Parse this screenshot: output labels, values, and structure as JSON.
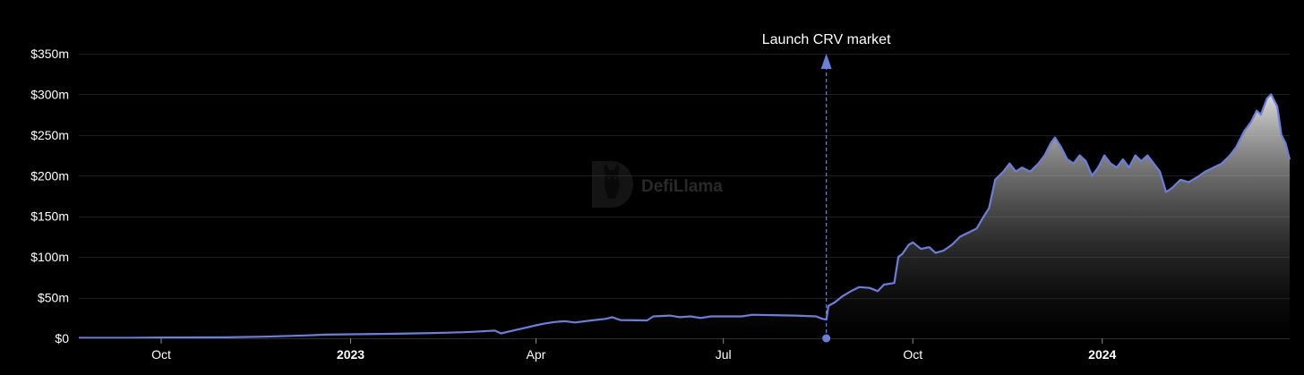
{
  "chart_data": {
    "type": "area",
    "title": "",
    "xlabel": "",
    "ylabel": "",
    "y_unit": "$",
    "ylim": [
      0,
      350
    ],
    "yticks": [
      {
        "value": 0,
        "label": "$0"
      },
      {
        "value": 50,
        "label": "$50m"
      },
      {
        "value": 100,
        "label": "$100m"
      },
      {
        "value": 150,
        "label": "$150m"
      },
      {
        "value": 200,
        "label": "$200m"
      },
      {
        "value": 250,
        "label": "$250m"
      },
      {
        "value": 300,
        "label": "$300m"
      },
      {
        "value": 350,
        "label": "$350m"
      }
    ],
    "xlim": [
      "2022-08-22",
      "2024-04-01"
    ],
    "xticks": [
      {
        "date": "2022-10-01",
        "label": "Oct",
        "bold": false
      },
      {
        "date": "2023-01-01",
        "label": "2023",
        "bold": true
      },
      {
        "date": "2023-04-01",
        "label": "Apr",
        "bold": false
      },
      {
        "date": "2023-07-01",
        "label": "Jul",
        "bold": false
      },
      {
        "date": "2023-10-01",
        "label": "Oct",
        "bold": false
      },
      {
        "date": "2024-01-01",
        "label": "2024",
        "bold": true
      }
    ],
    "grid": true,
    "line_color": "#6a7fdb",
    "fill_top_color": "#ffffff",
    "fill_bottom_color": "#000000",
    "background": "#000000",
    "annotation": {
      "date": "2023-08-20",
      "label": "Launch CRV market"
    },
    "watermark": "DefiLlama",
    "series": [
      {
        "points": [
          [
            "2022-08-22",
            0.5
          ],
          [
            "2022-09-15",
            0.6
          ],
          [
            "2022-10-01",
            1.0
          ],
          [
            "2022-11-01",
            1.2
          ],
          [
            "2022-11-20",
            2.0
          ],
          [
            "2022-12-10",
            3.5
          ],
          [
            "2022-12-20",
            4.5
          ],
          [
            "2023-01-01",
            5.0
          ],
          [
            "2023-01-20",
            5.5
          ],
          [
            "2023-02-10",
            6.5
          ],
          [
            "2023-02-25",
            7.5
          ],
          [
            "2023-03-05",
            8.5
          ],
          [
            "2023-03-12",
            9.5
          ],
          [
            "2023-03-15",
            6.0
          ],
          [
            "2023-03-20",
            9.0
          ],
          [
            "2023-03-27",
            13.0
          ],
          [
            "2023-04-01",
            16.0
          ],
          [
            "2023-04-05",
            18.0
          ],
          [
            "2023-04-10",
            20.0
          ],
          [
            "2023-04-15",
            21.0
          ],
          [
            "2023-04-20",
            19.5
          ],
          [
            "2023-04-28",
            22.0
          ],
          [
            "2023-05-05",
            24.0
          ],
          [
            "2023-05-08",
            26.0
          ],
          [
            "2023-05-12",
            22.5
          ],
          [
            "2023-05-25",
            22.0
          ],
          [
            "2023-05-28",
            27.0
          ],
          [
            "2023-06-05",
            28.0
          ],
          [
            "2023-06-10",
            26.0
          ],
          [
            "2023-06-15",
            27.0
          ],
          [
            "2023-06-20",
            25.0
          ],
          [
            "2023-06-25",
            27.0
          ],
          [
            "2023-07-01",
            27.0
          ],
          [
            "2023-07-10",
            27.0
          ],
          [
            "2023-07-15",
            29.0
          ],
          [
            "2023-07-25",
            28.5
          ],
          [
            "2023-08-05",
            28.0
          ],
          [
            "2023-08-15",
            27.0
          ],
          [
            "2023-08-18",
            24.0
          ],
          [
            "2023-08-20",
            23.0
          ],
          [
            "2023-08-21",
            40.0
          ],
          [
            "2023-08-24",
            44.0
          ],
          [
            "2023-08-28",
            52.0
          ],
          [
            "2023-09-01",
            58.0
          ],
          [
            "2023-09-05",
            63.0
          ],
          [
            "2023-09-10",
            62.0
          ],
          [
            "2023-09-14",
            58.0
          ],
          [
            "2023-09-17",
            66.0
          ],
          [
            "2023-09-22",
            68.0
          ],
          [
            "2023-09-24",
            100.0
          ],
          [
            "2023-09-26",
            104.0
          ],
          [
            "2023-09-29",
            115.0
          ],
          [
            "2023-10-01",
            118.0
          ],
          [
            "2023-10-05",
            110.0
          ],
          [
            "2023-10-09",
            112.0
          ],
          [
            "2023-10-12",
            105.0
          ],
          [
            "2023-10-16",
            108.0
          ],
          [
            "2023-10-20",
            115.0
          ],
          [
            "2023-10-24",
            125.0
          ],
          [
            "2023-10-28",
            130.0
          ],
          [
            "2023-11-01",
            135.0
          ],
          [
            "2023-11-04",
            148.0
          ],
          [
            "2023-11-07",
            160.0
          ],
          [
            "2023-11-10",
            195.0
          ],
          [
            "2023-11-14",
            205.0
          ],
          [
            "2023-11-17",
            215.0
          ],
          [
            "2023-11-20",
            205.0
          ],
          [
            "2023-11-23",
            210.0
          ],
          [
            "2023-11-27",
            205.0
          ],
          [
            "2023-12-01",
            215.0
          ],
          [
            "2023-12-04",
            225.0
          ],
          [
            "2023-12-07",
            240.0
          ],
          [
            "2023-12-09",
            247.0
          ],
          [
            "2023-12-12",
            235.0
          ],
          [
            "2023-12-15",
            220.0
          ],
          [
            "2023-12-18",
            215.0
          ],
          [
            "2023-12-21",
            225.0
          ],
          [
            "2023-12-24",
            218.0
          ],
          [
            "2023-12-27",
            200.0
          ],
          [
            "2023-12-30",
            210.0
          ],
          [
            "2024-01-02",
            225.0
          ],
          [
            "2024-01-05",
            215.0
          ],
          [
            "2024-01-08",
            210.0
          ],
          [
            "2024-01-11",
            220.0
          ],
          [
            "2024-01-14",
            210.0
          ],
          [
            "2024-01-17",
            225.0
          ],
          [
            "2024-01-20",
            218.0
          ],
          [
            "2024-01-23",
            225.0
          ],
          [
            "2024-01-26",
            215.0
          ],
          [
            "2024-01-29",
            205.0
          ],
          [
            "2024-02-01",
            180.0
          ],
          [
            "2024-02-04",
            185.0
          ],
          [
            "2024-02-08",
            195.0
          ],
          [
            "2024-02-12",
            192.0
          ],
          [
            "2024-02-16",
            198.0
          ],
          [
            "2024-02-20",
            205.0
          ],
          [
            "2024-02-24",
            210.0
          ],
          [
            "2024-02-28",
            215.0
          ],
          [
            "2024-03-03",
            225.0
          ],
          [
            "2024-03-06",
            235.0
          ],
          [
            "2024-03-10",
            255.0
          ],
          [
            "2024-03-13",
            265.0
          ],
          [
            "2024-03-16",
            280.0
          ],
          [
            "2024-03-18",
            275.0
          ],
          [
            "2024-03-21",
            295.0
          ],
          [
            "2024-03-23",
            300.0
          ],
          [
            "2024-03-26",
            285.0
          ],
          [
            "2024-03-28",
            250.0
          ],
          [
            "2024-03-30",
            240.0
          ],
          [
            "2024-04-01",
            220.0
          ]
        ]
      }
    ]
  }
}
